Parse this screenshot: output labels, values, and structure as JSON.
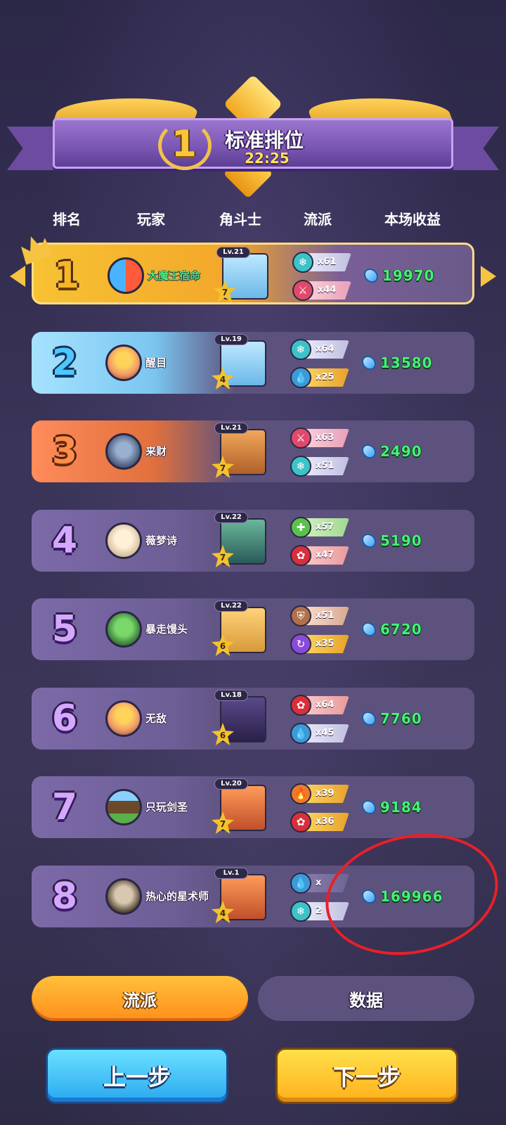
{
  "banner": {
    "rank": "1",
    "title": "标准排位",
    "time": "22:25"
  },
  "headers": {
    "rank": "排名",
    "player": "玩家",
    "fighter": "角斗士",
    "school": "流派",
    "income": "本场收益"
  },
  "rows": [
    {
      "rank": "1",
      "name": "大魔王宿命",
      "level": "Lv.21",
      "stars": "7",
      "school1": {
        "icon": "snowflake-icon",
        "count": "x61"
      },
      "school2": {
        "icon": "sword-icon",
        "count": "x44"
      },
      "income": "19970"
    },
    {
      "rank": "2",
      "name": "醒目",
      "level": "Lv.19",
      "stars": "4",
      "school1": {
        "icon": "snowflake-icon",
        "count": "x64"
      },
      "school2": {
        "icon": "water-drop-icon",
        "count": "x25"
      },
      "income": "13580"
    },
    {
      "rank": "3",
      "name": "来财",
      "level": "Lv.21",
      "stars": "7",
      "school1": {
        "icon": "sword-icon",
        "count": "x63"
      },
      "school2": {
        "icon": "snowflake-icon",
        "count": "x51"
      },
      "income": "2490"
    },
    {
      "rank": "4",
      "name": "薇梦诗",
      "level": "Lv.22",
      "stars": "7",
      "school1": {
        "icon": "heal-cross-icon",
        "count": "x57"
      },
      "school2": {
        "icon": "fire-lotus-icon",
        "count": "x47"
      },
      "income": "5190"
    },
    {
      "rank": "5",
      "name": "暴走馒头",
      "level": "Lv.22",
      "stars": "6",
      "school1": {
        "icon": "shield-icon",
        "count": "x51"
      },
      "school2": {
        "icon": "cycle-icon",
        "count": "x35"
      },
      "income": "6720"
    },
    {
      "rank": "6",
      "name": "无敌",
      "level": "Lv.18",
      "stars": "6",
      "school1": {
        "icon": "fire-lotus-icon",
        "count": "x64"
      },
      "school2": {
        "icon": "water-drop-icon",
        "count": "x45"
      },
      "income": "7760"
    },
    {
      "rank": "7",
      "name": "只玩剑圣",
      "level": "Lv.20",
      "stars": "7",
      "school1": {
        "icon": "flame-icon",
        "count": "x39"
      },
      "school2": {
        "icon": "fire-lotus-icon",
        "count": "x36"
      },
      "income": "9184"
    },
    {
      "rank": "8",
      "name": "热心的星术师",
      "level": "Lv.1",
      "stars": "4",
      "school1": {
        "icon": "water-drop-icon",
        "count": "x"
      },
      "school2": {
        "icon": "snowflake-icon",
        "count": "2"
      },
      "income": "169966"
    }
  ],
  "tabs": {
    "school": "流派",
    "data": "数据"
  },
  "buttons": {
    "prev": "上一步",
    "next": "下一步"
  },
  "colors": {
    "income": "#46f07a",
    "accent_gold": "#f6c342",
    "row_bg": "#5d527e",
    "annotation": "#e8202a"
  }
}
